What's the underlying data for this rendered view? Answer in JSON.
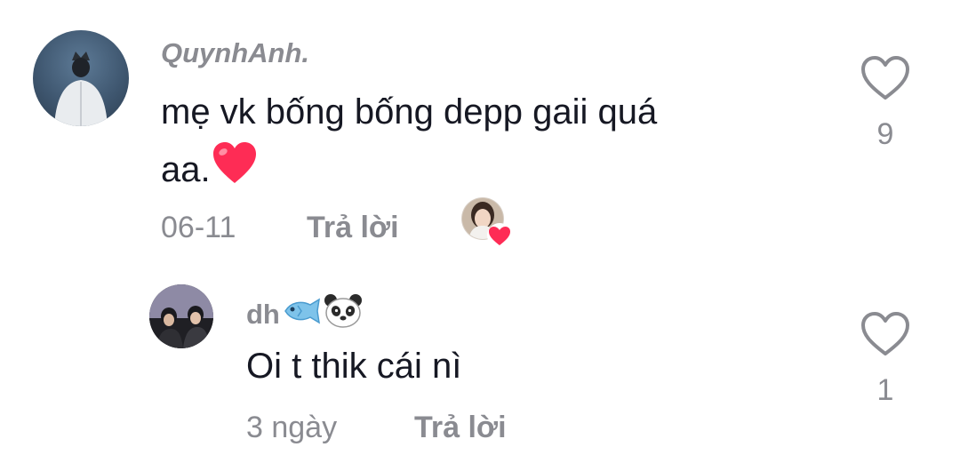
{
  "comments": [
    {
      "username": "QuynhAnh.",
      "text_line1": "mẹ vk bống bống depp gaii quá",
      "text_line2": "aa.",
      "inline_emoji": "heart-emoji",
      "date": "06-11",
      "reply_label": "Trả lời",
      "like_count": "9",
      "liked_by_creator": true
    },
    {
      "username": "dh",
      "username_emojis": [
        "fish-emoji",
        "panda-emoji"
      ],
      "text": "Oi t thik cái nì",
      "date": "3 ngày",
      "reply_label": "Trả lời",
      "like_count": "1"
    }
  ],
  "colors": {
    "secondary_text": "#8a8b91",
    "primary_text": "#161823",
    "heart_red": "#fe2c55"
  }
}
